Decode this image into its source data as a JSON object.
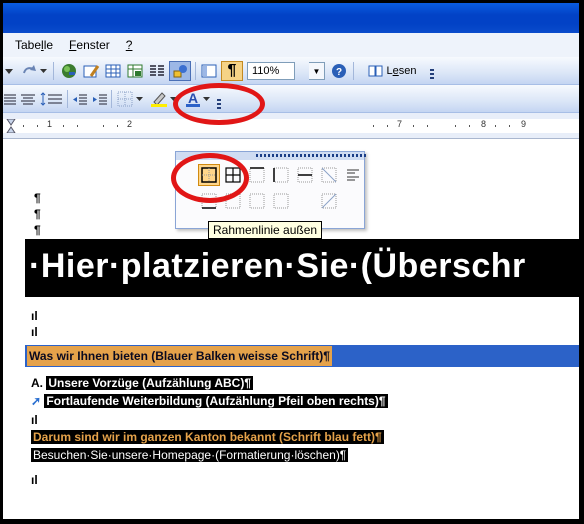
{
  "menu": {
    "items": [
      {
        "label": "Tabe",
        "underline": "l",
        "rest": "le"
      },
      {
        "label": "",
        "underline": "F",
        "rest": "enster"
      },
      {
        "label": "",
        "underline": "?",
        "rest": ""
      }
    ]
  },
  "toolbar1": {
    "zoom_value": "110%",
    "read_label": "Lesen",
    "read_underline": "e"
  },
  "palette": {
    "tooltip": "Rahmenlinie außen"
  },
  "ruler": {
    "marks": [
      "1",
      "2",
      "7",
      "8",
      "9"
    ]
  },
  "document": {
    "heading": "·Hier·platzieren·Sie·(Überschr",
    "pilcrow": "¶",
    "small_mark": "ıl",
    "line_blue_bar": "Was wir Ihnen bieten (Blauer Balken weisse Schrift)¶",
    "list_a_marker": "A.",
    "list_a_text": "Unsere Vorzüge (Aufzählung ABC)¶",
    "list_arrow_marker": "➚",
    "list_arrow_text": "Fortlaufende Weiterbildung (Aufzählung Pfeil oben rechts)¶",
    "line_orange": "Darum sind wir im ganzen Kanton bekannt (Schrift blau fett)¶",
    "line_plain": "Besuchen·Sie·unsere·Homepage·(Formatierung·löschen)¶"
  },
  "colors": {
    "title_bar": "#0242c6",
    "heading_bg": "#000000",
    "blue_bar": "#2c62c8",
    "orange_text": "#e5a24a",
    "highlight_ring": "#e11616",
    "tooltip_bg": "#ffffe1"
  }
}
